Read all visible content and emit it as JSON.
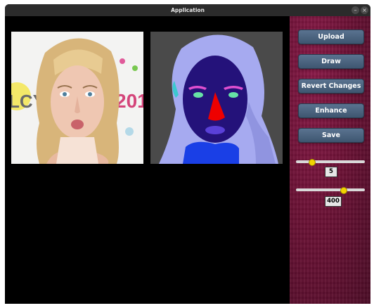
{
  "window": {
    "title": "Application"
  },
  "titlebar": {
    "minimize_glyph": "–",
    "close_glyph": "×"
  },
  "toolbar": {
    "upload_label": "Upload",
    "draw_label": "Draw",
    "revert_label": "Revert Changes",
    "enhance_label": "Enhance",
    "save_label": "Save"
  },
  "sliders": {
    "brush_size": {
      "value": "5",
      "fraction": 0.2
    },
    "resolution": {
      "value": "400",
      "fraction": 0.72
    }
  },
  "colors": {
    "accent_button": "#4a627d",
    "sidebar_bg": "#6d1236",
    "slider_thumb": "#f1d400",
    "seg_background": "#4a4a4a",
    "seg_hair": "#a6aaf0",
    "seg_face": "#24127a",
    "seg_nose": "#ee0000",
    "seg_brows": "#e04fd0",
    "seg_eyes": "#66e2a6",
    "seg_lips": "#5a40d8",
    "seg_neck": "#1a3fe6"
  }
}
